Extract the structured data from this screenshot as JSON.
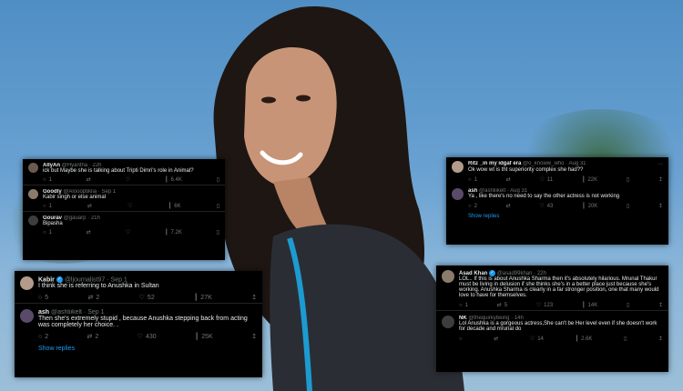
{
  "card1": {
    "tweets": [
      {
        "name": "AllyAn",
        "handle": "@Hyantha",
        "time": "22h",
        "text": "ick but Maybe she is talking about Tripti Dimri's role in Animal?",
        "replies": "1",
        "retweets": "",
        "likes": "",
        "views": "6.4K"
      },
      {
        "name": "Goodly",
        "handle": "@Aloooptiklia",
        "time": "Sep 1",
        "text": "Kabir singh or else animal",
        "replies": "1",
        "retweets": "",
        "likes": "",
        "views": "6K"
      },
      {
        "name": "Gourav",
        "handle": "@gauarp",
        "time": "21h",
        "text": "Bipasha",
        "replies": "1",
        "retweets": "",
        "likes": "",
        "views": "7.2K"
      }
    ]
  },
  "card2": {
    "tweets": [
      {
        "name": "Ritz _in my idgaf era",
        "handle": "@o_knoww_who",
        "time": "Aug 31",
        "text": "Ok wow wt is tht superiority complex she had??",
        "replies": "1",
        "retweets": "",
        "likes": "11",
        "views": "22K"
      },
      {
        "name": "ash",
        "handle": "@ashliikelt",
        "time": "Aug 31",
        "text": "Ya , like there's no need to say the other actress is not working",
        "replies": "2",
        "retweets": "",
        "likes": "43",
        "views": "20K"
      }
    ],
    "show_replies": "Show replies"
  },
  "card3": {
    "tweets": [
      {
        "name": "Kabir",
        "handle": "@ljournalist97",
        "time": "Sep 1",
        "text": "I think she is referring to Anushka in Sultan",
        "replies": "5",
        "retweets": "2",
        "likes": "52",
        "views": "27K"
      },
      {
        "name": "ash",
        "handle": "@ashliikelt",
        "time": "Sep 1",
        "text": "Then she's extremely stupid , because Anushka stepping back from acting was completely her choice. .",
        "replies": "2",
        "retweets": "2",
        "likes": "430",
        "views": "25K"
      }
    ],
    "show_replies": "Show replies"
  },
  "card4": {
    "tweets": [
      {
        "name": "Asad Khan",
        "handle": "@asad99khan",
        "time": "22h",
        "text": "LOL.. If this is about Anushka Sharma then it's absolutely hilarious. Mrunal Thakur must be living in delusion if she thinks she's in a better place just because she's working. Anushka Sharma is clearly in a far stronger position, one that many would love to have for themselves.",
        "replies": "1",
        "retweets": "5",
        "likes": "123",
        "views": "14K"
      },
      {
        "name": "NK",
        "handle": "@thequirkybeing",
        "time": "14h",
        "text": "Lol Anushka is a gorgeous actress,She can't be Her level even if she doesn't work for decade and mrunal do",
        "replies": "",
        "retweets": "",
        "likes": "14",
        "views": "2.6K"
      }
    ]
  },
  "icons": {
    "reply": "○",
    "retweet": "⇄",
    "like": "♡",
    "views": "┃",
    "bookmark": "▯",
    "share": "↥",
    "more": "⋯"
  }
}
